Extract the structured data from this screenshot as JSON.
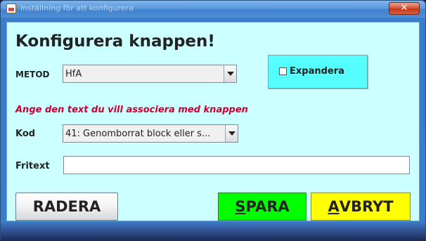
{
  "window": {
    "title": "Inställning för att konfigurera",
    "close_glyph": "✕"
  },
  "heading": "Konfigurera knappen!",
  "metod": {
    "label": "METOD",
    "value": "HfA"
  },
  "expand": {
    "label": "Expandera",
    "checked": false
  },
  "hint": "Ange den text du vill associera med knappen",
  "kod": {
    "label": "Kod",
    "value": "41: Genomborrat block eller s..."
  },
  "fritext": {
    "label": "Fritext",
    "value": ""
  },
  "buttons": {
    "radera": "RADERA",
    "spara_mnemonic": "S",
    "spara_rest": "PARA",
    "avbryt_mnemonic": "A",
    "avbryt_rest": "VBRYT"
  },
  "colors": {
    "panel_bg": "#ccffff",
    "expand_bg": "#55ffff",
    "hint_color": "#cc0033",
    "spara_bg": "#00ff00",
    "avbryt_bg": "#ffff00"
  }
}
